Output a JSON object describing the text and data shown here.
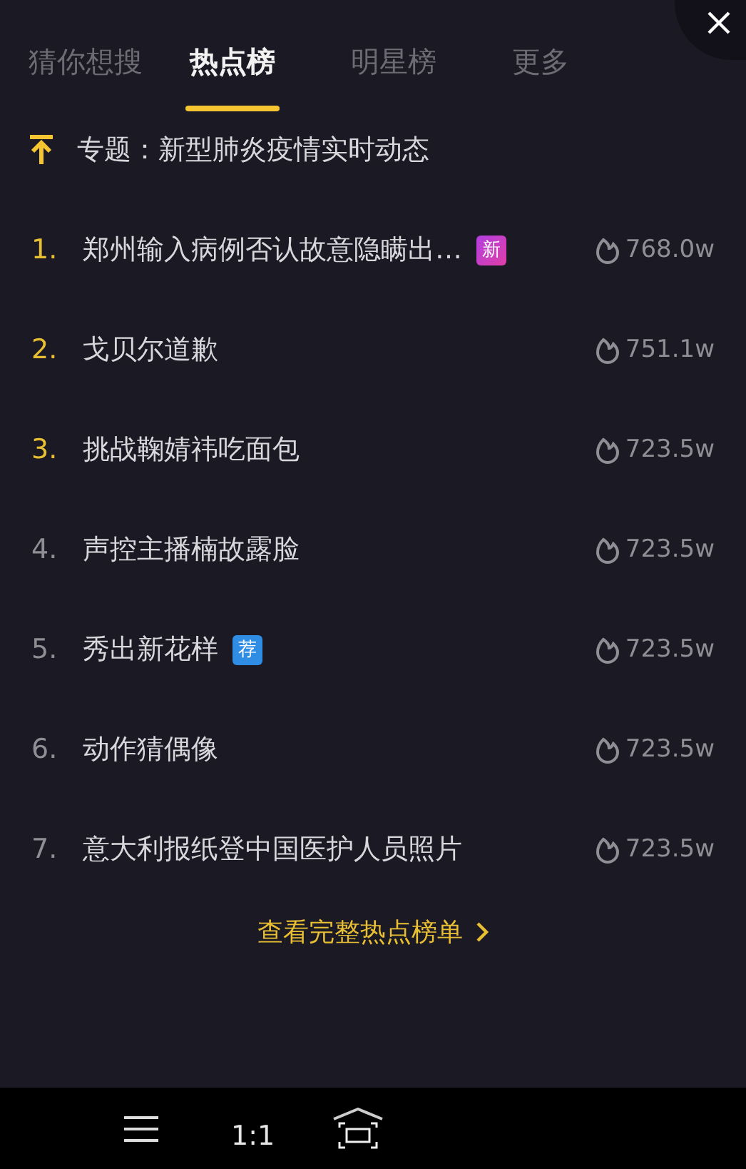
{
  "tabs": [
    {
      "label": "猜你想搜",
      "selected": false
    },
    {
      "label": "热点榜",
      "selected": true
    },
    {
      "label": "明星榜",
      "selected": false
    },
    {
      "label": "更多",
      "selected": false
    }
  ],
  "pinned": {
    "text": "专题：新型肺炎疫情实时动态"
  },
  "items": [
    {
      "rank": "1.",
      "title": "郑州输入病例否认故意隐瞒出…",
      "highlighted": true,
      "badge": {
        "kind": "new",
        "text": "新"
      },
      "heat": "768.0w"
    },
    {
      "rank": "2.",
      "title": "戈贝尔道歉",
      "highlighted": true,
      "heat": "751.1w"
    },
    {
      "rank": "3.",
      "title": "挑战鞠婧祎吃面包",
      "highlighted": true,
      "heat": "723.5w"
    },
    {
      "rank": "4.",
      "title": "声控主播楠故露脸",
      "highlighted": false,
      "heat": "723.5w"
    },
    {
      "rank": "5.",
      "title": "秀出新花样",
      "highlighted": false,
      "badge": {
        "kind": "recommend",
        "text": "荐"
      },
      "heat": "723.5w"
    },
    {
      "rank": "6.",
      "title": "动作猜偶像",
      "highlighted": false,
      "heat": "723.5w"
    },
    {
      "rank": "7.",
      "title": "意大利报纸登中国医护人员照片",
      "highlighted": false,
      "heat": "723.5w"
    }
  ],
  "more_link": "查看完整热点榜单",
  "bottom_bar": {
    "ratio": "1:1"
  }
}
